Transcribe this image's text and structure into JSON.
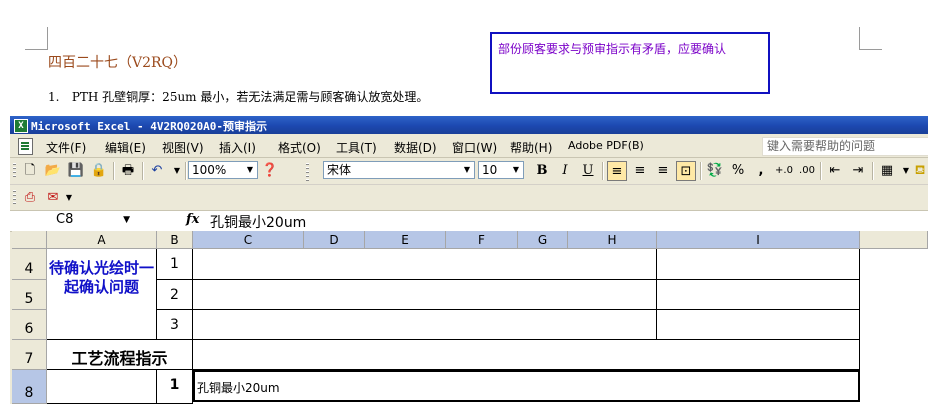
{
  "document": {
    "heading": "四百二十七（V2RQ）",
    "list_item_number": "1.",
    "list_item_text": "PTH 孔壁铜厚：25um 最小，若无法满足需与顾客确认放宽处理。",
    "comment": "部份顾客要求与预审指示有矛盾，应要确认"
  },
  "excel": {
    "title": "Microsoft Excel - 4V2RQ020A0-预审指示",
    "menu": [
      "文件(F)",
      "编辑(E)",
      "视图(V)",
      "插入(I)",
      "格式(O)",
      "工具(T)",
      "数据(D)",
      "窗口(W)",
      "帮助(H)",
      "Adobe PDF(B)"
    ],
    "help_placeholder": "键入需要帮助的问题",
    "toolbar": {
      "zoom": "100%",
      "font_name": "宋体",
      "font_size": "10",
      "bold": "B",
      "italic": "I",
      "underline": "U",
      "percent": "%",
      "comma": ","
    },
    "formula_bar": {
      "name_box": "C8",
      "fx": "fx",
      "content": "孔铜最小20um"
    },
    "columns": [
      "A",
      "B",
      "C",
      "D",
      "E",
      "F",
      "G",
      "H",
      "I"
    ],
    "rows": [
      "4",
      "5",
      "6",
      "7",
      "8"
    ],
    "cells": {
      "a4_merged": "待确认光绘时一起确认问题",
      "b4": "1",
      "b5": "2",
      "b6": "3",
      "a7": "工艺流程指示",
      "b8": "1",
      "c8": "孔铜最小20um"
    }
  }
}
